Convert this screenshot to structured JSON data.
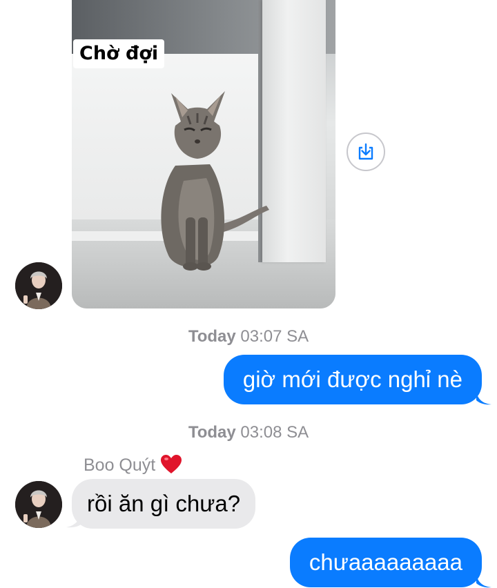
{
  "image_message": {
    "caption": "Chờ đợi",
    "subject": "gray tabby cat sitting on a step",
    "save_icon": "save-download-icon"
  },
  "messages": [
    {
      "timestamp_day": "Today",
      "timestamp_time": "03:07 SA"
    },
    {
      "direction": "outgoing",
      "text": "giờ mới được nghỉ nè"
    },
    {
      "timestamp_day": "Today",
      "timestamp_time": "03:08 SA"
    },
    {
      "sender": "Boo Quýt",
      "sender_emoji": "red-heart"
    },
    {
      "direction": "incoming",
      "text": "rồi ăn gì chưa?"
    },
    {
      "direction": "outgoing",
      "text": "chưaaaaaaaaa"
    }
  ],
  "colors": {
    "outgoing_bubble": "#0a7cff",
    "incoming_bubble": "#e9e9eb",
    "timestamp_text": "#8e8e93"
  }
}
